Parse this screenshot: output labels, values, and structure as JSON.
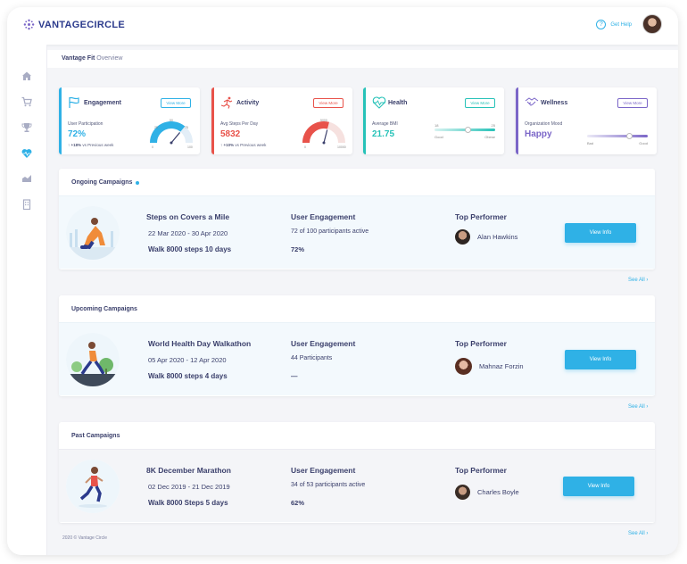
{
  "brand": {
    "name": "VANTAGECIRCLE"
  },
  "header": {
    "help_label": "Get Help"
  },
  "sidebar": {
    "items": [
      {
        "icon": "home-icon"
      },
      {
        "icon": "cart-icon"
      },
      {
        "icon": "trophy-icon"
      },
      {
        "icon": "heart-icon",
        "active": true
      },
      {
        "icon": "chart-icon"
      },
      {
        "icon": "building-icon"
      }
    ]
  },
  "breadcrumb": {
    "title": "Vantage Fit",
    "subtitle": "Overview"
  },
  "kpis": {
    "engagement": {
      "title": "Engagement",
      "button": "View More",
      "label": "User Participation",
      "value": "72%",
      "change": "+18%",
      "change_note": "vs Previous week",
      "gauge_min": "0",
      "gauge_max": "100",
      "ticks": [
        "25",
        "50",
        "75"
      ],
      "level": 0.72,
      "color": "#2fb1e6"
    },
    "activity": {
      "title": "Activity",
      "button": "View More",
      "label": "Avg Steps Per Day",
      "value": "5832",
      "change": "+10%",
      "change_note": "vs Previous week",
      "gauge_min": "0",
      "gauge_max": "10000",
      "ticks": [
        "5000"
      ],
      "level": 0.58,
      "color": "#e8524a"
    },
    "health": {
      "title": "Health",
      "button": "View More",
      "label": "Average BMI",
      "value": "21.75",
      "scale_low": "18",
      "scale_high": "25",
      "low_label": "Good",
      "high_label": "Obese",
      "color": "#27c2b8"
    },
    "wellness": {
      "title": "Wellness",
      "button": "View More",
      "label": "Organization Mood",
      "value": "Happy",
      "low_label": "Bad",
      "high_label": "Good",
      "color": "#7b66c8"
    }
  },
  "sections": [
    {
      "title": "Ongoing Campaigns",
      "indicator": true,
      "campaign": "Steps on Covers a Mile",
      "dates": "22 Mar 2020 - 30 Apr 2020",
      "goal": "Walk 8000 steps 10 days",
      "eng_head": "User Engagement",
      "participants": "72 of 100 participants active",
      "percent": "72%",
      "top_head": "Top Performer",
      "performer": "Alan Hawkins",
      "button": "View Info",
      "see_all": "See All ›"
    },
    {
      "title": "Upcoming Campaigns",
      "indicator": false,
      "campaign": "World Health Day Walkathon",
      "dates": "05 Apr 2020 - 12 Apr 2020",
      "goal": "Walk 8000 steps 4 days",
      "eng_head": "User Engagement",
      "participants": "44 Participants",
      "percent": "—",
      "top_head": "Top Performer",
      "performer": "Mahnaz Forzin",
      "button": "View Info",
      "see_all": "See All ›"
    },
    {
      "title": "Past Campaigns",
      "indicator": false,
      "campaign": "8K December Marathon",
      "dates": "02 Dec 2019 -  21 Dec 2019",
      "goal": "Walk 8000 Steps 5 days",
      "eng_head": "User Engagement",
      "participants": "34 of 53 participants active",
      "percent": "62%",
      "top_head": "Top Performer",
      "performer": "Charles Boyle",
      "button": "View Info",
      "see_all": "See All ›"
    }
  ],
  "footer": {
    "copyright": "2020 © Vantage Circle"
  }
}
